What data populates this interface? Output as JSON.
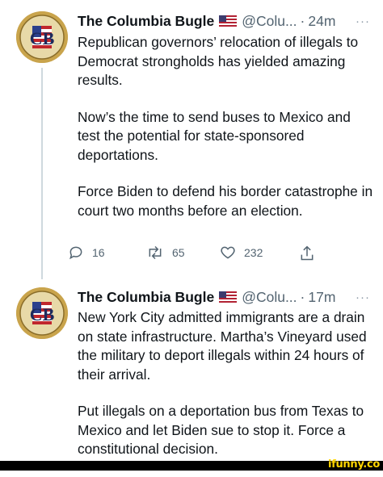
{
  "tweets": [
    {
      "author": "The Columbia Bugle",
      "handle": "@Colu...",
      "time": "24m",
      "more": "···",
      "paragraphs": [
        "Republican governors’ relocation of illegals to Democrat strongholds has yielded amazing results.",
        "Now’s the time to send buses to Mexico and test the potential for state-sponsored deportations.",
        "Force Biden to defend his border catastrophe in court two months before an election."
      ],
      "replies": "16",
      "retweets": "65",
      "likes": "232"
    },
    {
      "author": "The Columbia Bugle",
      "handle": "@Colu...",
      "time": "17m",
      "more": "···",
      "paragraphs": [
        "New York City admitted immigrants are a drain on state infrastructure. Martha’s Vineyard used the military to deport illegals within 24 hours of their arrival.",
        "Put illegals on a deportation bus from Texas to Mexico and let Biden sue to stop it. Force a constitutional decision."
      ]
    }
  ],
  "watermark": "ifunny.co",
  "colors": {
    "secondary": "#536471",
    "thread_line": "#cfd9de",
    "watermark": "#ffd500"
  }
}
